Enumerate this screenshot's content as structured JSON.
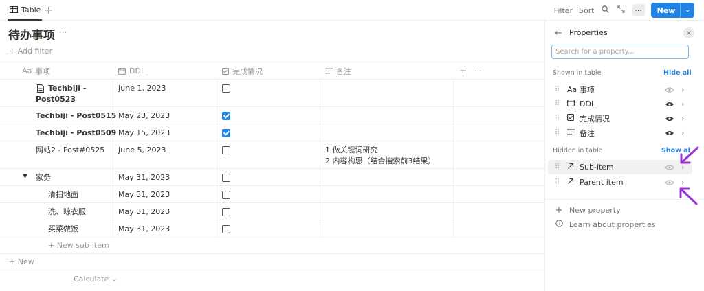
{
  "topbar": {
    "view_tab_label": "Table",
    "add_view": "+",
    "filter": "Filter",
    "sort": "Sort",
    "more": "···",
    "new_label": "New",
    "new_caret": "⌄"
  },
  "page": {
    "title": "待办事项",
    "title_more": "···",
    "add_filter": "+ Add filter"
  },
  "table": {
    "columns": [
      {
        "label": "事项",
        "icon_text": "Aa"
      },
      {
        "label": "DDL",
        "icon": "calendar-icon"
      },
      {
        "label": "完成情况",
        "icon": "checkbox-icon"
      },
      {
        "label": "备注",
        "icon": "text-lines-icon"
      }
    ],
    "add_column": "+",
    "column_more": "···",
    "rows": [
      {
        "name_line1": "Techbiji -",
        "name_line2": "Post0523",
        "ddl": "June 1, 2023",
        "done": false,
        "note1": "",
        "note2": ""
      },
      {
        "name_line1": "Techbiji - Post0515",
        "name_line2": "",
        "ddl": "May 23, 2023",
        "done": true,
        "note1": "",
        "note2": ""
      },
      {
        "name_line1": "Techbiji - Post0509",
        "name_line2": "",
        "ddl": "May 15, 2023",
        "done": true,
        "note1": "",
        "note2": ""
      },
      {
        "name_line1": "网站2 - Post#0525",
        "name_line2": "",
        "ddl": "June 5, 2023",
        "done": false,
        "note1": "1 做关键词研究",
        "note2": "2 内容构思（结合搜索前3结果）"
      },
      {
        "name_line1": "家务",
        "name_line2": "",
        "ddl": "May 31, 2023",
        "done": false,
        "note1": "",
        "note2": ""
      },
      {
        "name_line1": "清扫地面",
        "name_line2": "",
        "ddl": "May 31, 2023",
        "done": false,
        "note1": "",
        "note2": ""
      },
      {
        "name_line1": "洗、晾衣服",
        "name_line2": "",
        "ddl": "May 31, 2023",
        "done": false,
        "note1": "",
        "note2": ""
      },
      {
        "name_line1": "买菜做饭",
        "name_line2": "",
        "ddl": "May 31, 2023",
        "done": false,
        "note1": "",
        "note2": ""
      }
    ],
    "toggle_arrow": "▼",
    "new_sub_item": "+ New sub-item",
    "new_row": "+ New",
    "calculate": "Calculate ⌄"
  },
  "panel": {
    "back": "←",
    "title": "Properties",
    "close": "×",
    "search_placeholder": "Search for a property...",
    "shown_label": "Shown in table",
    "hide_all": "Hide all",
    "shown": [
      {
        "icon_text": "Aa",
        "label": "事项"
      },
      {
        "icon": "calendar-icon",
        "label": "DDL"
      },
      {
        "icon": "checkbox-icon",
        "label": "完成情况"
      },
      {
        "icon": "text-lines-icon",
        "label": "备注"
      }
    ],
    "hidden_label": "Hidden in table",
    "show_all": "Show al",
    "hidden": [
      {
        "icon": "relation-arrow-icon",
        "label": "Sub-item"
      },
      {
        "icon": "relation-arrow-icon",
        "label": "Parent item"
      }
    ],
    "new_property": "New property",
    "learn": "Learn about properties"
  },
  "colors": {
    "accent": "#2383e2",
    "annotation_arrow": "#9b30d9"
  }
}
